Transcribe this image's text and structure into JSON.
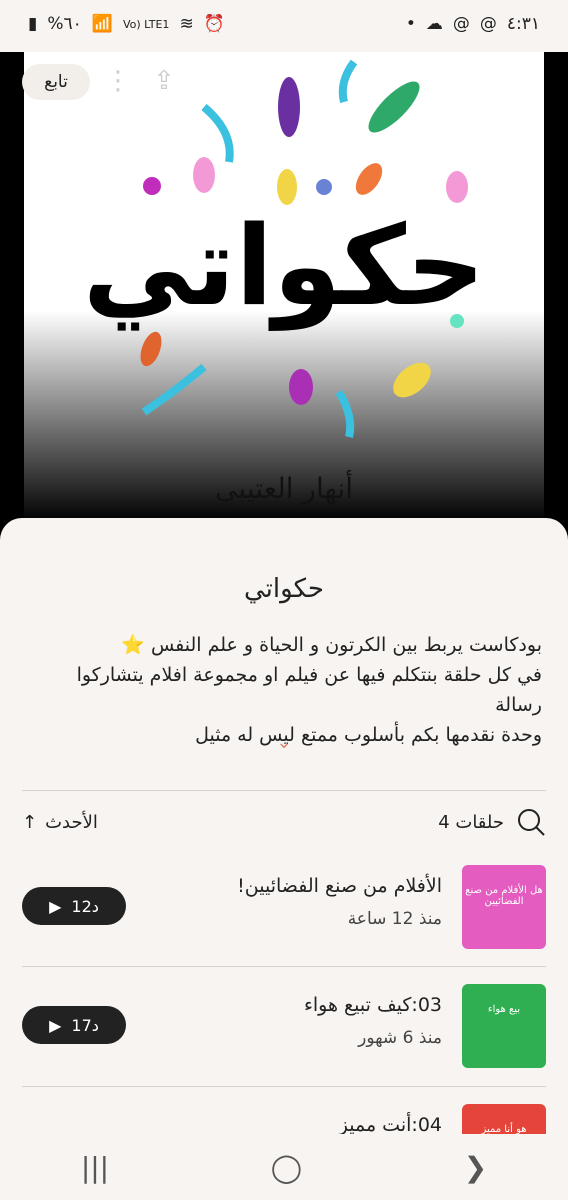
{
  "status": {
    "left": "%٦٠",
    "network": "Vo) LTE1",
    "time": "٤:٣١"
  },
  "follow_label": "تابع",
  "cover": {
    "title": "حكواتي",
    "author": "أنهار العتيبي"
  },
  "podcast": {
    "title": "حكواتي",
    "description_line1": "بودكاست يربط بين الكرتون و الحياة و علم النفس ⭐",
    "description_line2": "في كل حلقة بنتكلم فيها عن فيلم او مجموعة افلام يتشاركوا رسالة",
    "description_line3": "وحدة نقدمها بكم بأسلوب ممتع ليس له مثيل"
  },
  "toolbar": {
    "sort_label": "الأحدث",
    "episodes_count": "4 حلقات"
  },
  "episodes": [
    {
      "title": "الأفلام من صنع الفضائيين!",
      "date": "منذ 12 ساعة",
      "duration": "12د"
    },
    {
      "title": "03:كيف تبيع هواء",
      "date": "منذ 6 شهور",
      "duration": "17د"
    },
    {
      "title": "04:أنت مميز",
      "date": "",
      "duration": ""
    }
  ],
  "thumbs": [
    "هل الأفلام من صنع الفضائيين",
    "بيع هواء",
    "هو أنا مميز"
  ],
  "icons": [
    "search-icon",
    "arrow-up-icon",
    "share-icon",
    "more-icon",
    "play-icon",
    "chevron-down-icon"
  ]
}
